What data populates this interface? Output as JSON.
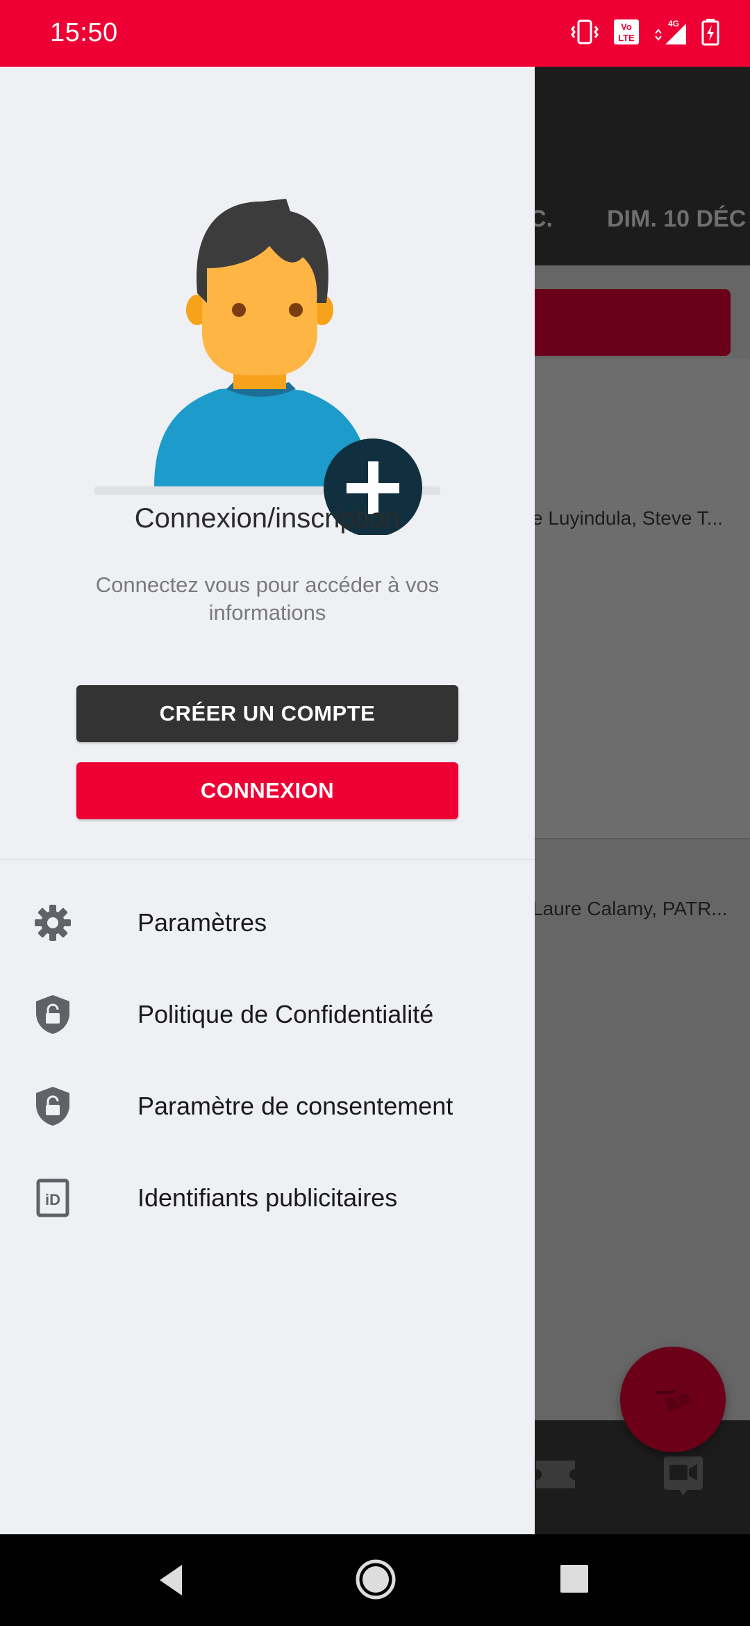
{
  "status_bar": {
    "time": "15:50",
    "icons": [
      "vibrate-icon",
      "volte-icon",
      "signal-4g-icon",
      "battery-charging-icon"
    ]
  },
  "background": {
    "tabs": [
      "C.",
      "DIM. 10 DÉC"
    ],
    "cast_line_1": "e Luyindula, Steve T...",
    "cast_line_2": "Laure Calamy, PATR...",
    "colors": {
      "accent": "#ee0034",
      "dim": "#666666"
    }
  },
  "drawer": {
    "title": "Connexion/inscription",
    "subtitle": "Connectez vous pour accéder à vos informations",
    "create_account_label": "CRÉER UN COMPTE",
    "login_label": "CONNEXION",
    "menu": [
      {
        "label": "Paramètres",
        "icon": "gear-icon"
      },
      {
        "label": "Politique de Confidentialité",
        "icon": "shield-lock-icon"
      },
      {
        "label": "Paramètre de consentement",
        "icon": "shield-lock-icon"
      },
      {
        "label": "Identifiants publicitaires",
        "icon": "id-card-icon"
      }
    ]
  },
  "nav_bar": {
    "buttons": [
      "back-icon",
      "home-icon",
      "recents-icon"
    ]
  }
}
